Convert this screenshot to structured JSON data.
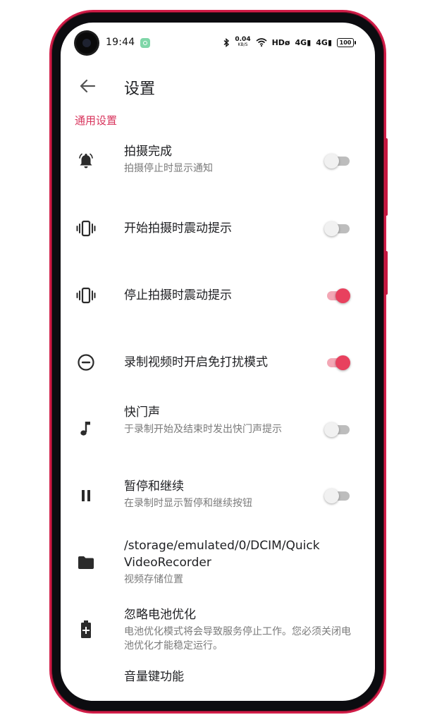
{
  "status_bar": {
    "time": "19:44",
    "net_speed": "0.04",
    "net_speed_unit": "KB/S",
    "hd_label": "HDø",
    "signal1": "4G",
    "signal2": "4G",
    "battery": "100"
  },
  "header": {
    "title": "设置"
  },
  "section": {
    "label": "通用设置"
  },
  "items": [
    {
      "title": "拍摄完成",
      "subtitle": "拍摄停止时显示通知",
      "icon": "bell-icon",
      "toggle": false
    },
    {
      "title": "开始拍摄时震动提示",
      "icon": "vibrate-icon",
      "toggle": false
    },
    {
      "title": "停止拍摄时震动提示",
      "icon": "vibrate-icon",
      "toggle": true
    },
    {
      "title": "录制视频时开启免打扰模式",
      "icon": "do-not-disturb-icon",
      "toggle": true
    },
    {
      "title": "快门声",
      "subtitle": "于录制开始及结束时发出快门声提示",
      "icon": "music-note-icon",
      "toggle": false
    },
    {
      "title": "暂停和继续",
      "subtitle": "在录制时显示暂停和继续按钮",
      "icon": "pause-icon",
      "toggle": false
    },
    {
      "title": "/storage/emulated/0/DCIM/QuickVideoRecorder",
      "subtitle": "视频存储位置",
      "icon": "folder-icon"
    },
    {
      "title": "忽略电池优化",
      "subtitle": "电池优化模式将会导致服务停止工作。您必须关闭电池优化才能稳定运行。",
      "icon": "battery-plus-icon"
    },
    {
      "title": "音量键功能",
      "icon": "volume-icon"
    }
  ],
  "colors": {
    "accent": "#e8415e",
    "frame": "#d11d48"
  }
}
